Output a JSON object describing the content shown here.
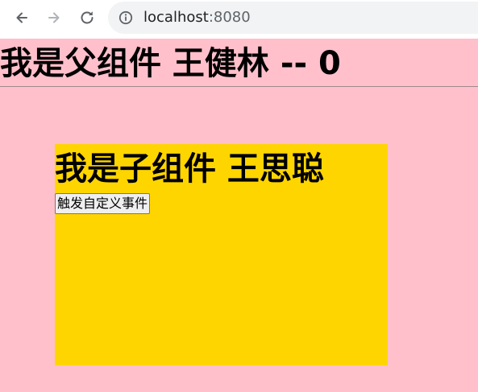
{
  "browser": {
    "url_host": "localhost",
    "url_port": ":8080",
    "icons": {
      "back": "arrow-left-icon",
      "forward": "arrow-right-icon",
      "reload": "reload-icon",
      "info": "info-icon"
    }
  },
  "parent": {
    "title": "我是父组件 王健林 -- 0",
    "background_color": "#ffc0cb"
  },
  "child": {
    "title": "我是子组件 王思聪",
    "button_label": "触发自定义事件",
    "background_color": "#ffd500"
  }
}
